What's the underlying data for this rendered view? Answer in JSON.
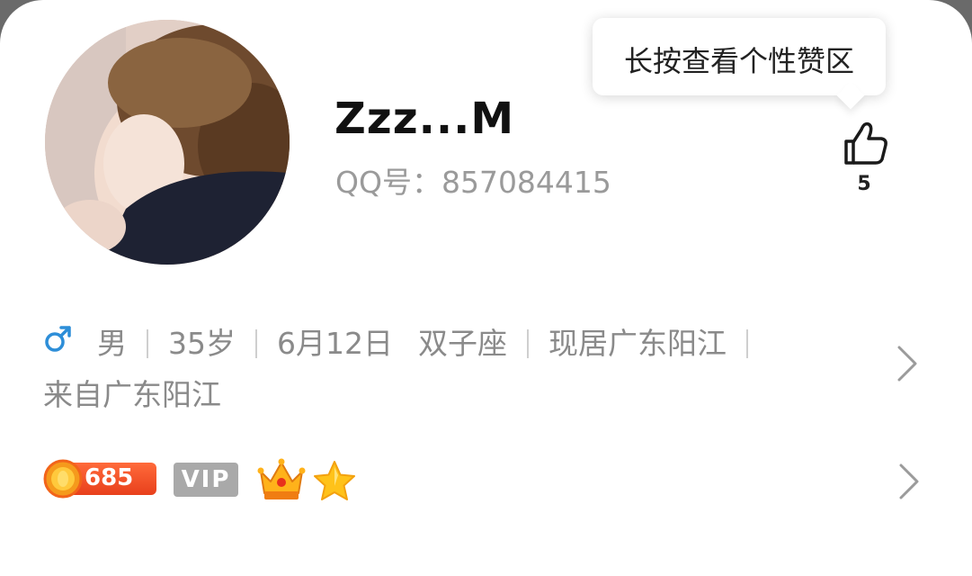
{
  "profile": {
    "nickname": "Zzz...M",
    "qq_label": "QQ号：",
    "qq_number": "857084415",
    "avatar_icon": "child-photo-avatar"
  },
  "like": {
    "tooltip": "长按查看个性赞区",
    "count": "5",
    "icon": "thumbs-up-icon"
  },
  "info": {
    "gender_icon": "male-symbol-icon",
    "gender": "男",
    "age": "35岁",
    "birthday": "6月12日",
    "zodiac": "双子座",
    "current_city": "现居广东阳江",
    "hometown": "来自广东阳江"
  },
  "badges": {
    "coin_count": "685",
    "vip_label": "VIP",
    "crown_icon": "crown-icon",
    "star_icon": "star-icon"
  },
  "colors": {
    "male_blue": "#2d8ed8",
    "coin_orange": "#e8401c",
    "vip_gray": "#a9a9a9",
    "star_gold": "#ffc21a"
  }
}
